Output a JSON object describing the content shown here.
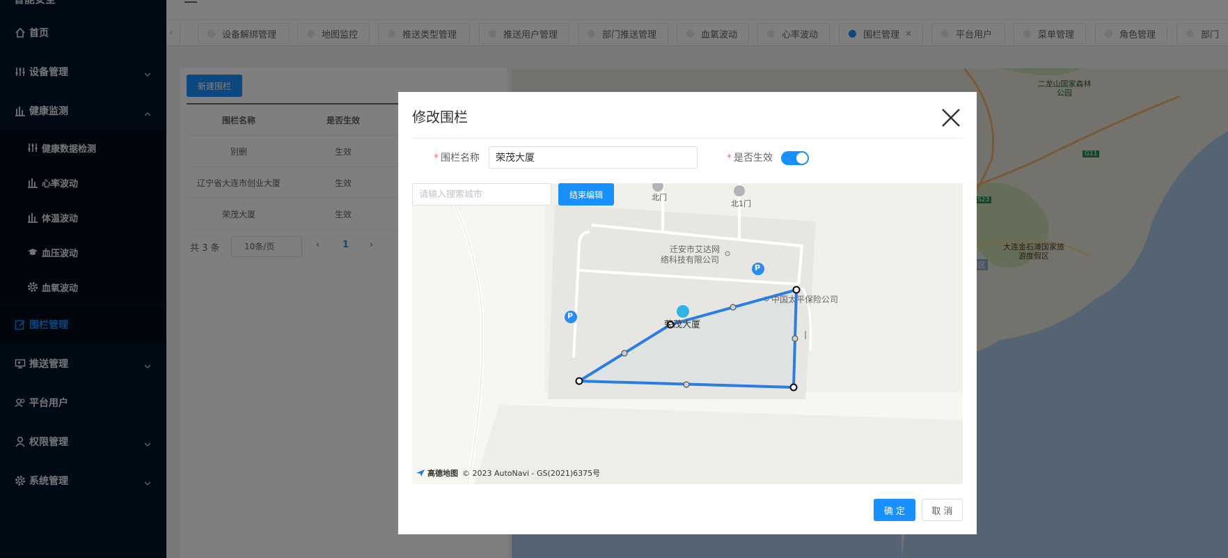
{
  "sidebar": {
    "logo_text": "智能安全",
    "items": [
      {
        "label": "首页",
        "icon": "home-icon"
      },
      {
        "label": "设备管理",
        "icon": "sliders-icon"
      },
      {
        "label": "健康监测",
        "icon": "bar-chart-icon"
      },
      {
        "label": "健康数据检测",
        "icon": "sliders-icon"
      },
      {
        "label": "心率波动",
        "icon": "bar-chart-icon"
      },
      {
        "label": "体温波动",
        "icon": "bar-chart-icon"
      },
      {
        "label": "血压波动",
        "icon": "graduation-cap-icon"
      },
      {
        "label": "血氧波动",
        "icon": "gear-icon"
      },
      {
        "label": "围栏管理",
        "icon": "edit-icon"
      },
      {
        "label": "推送管理",
        "icon": "push-icon"
      },
      {
        "label": "平台用户",
        "icon": "users-icon"
      },
      {
        "label": "权限管理",
        "icon": "user-icon"
      },
      {
        "label": "系统管理",
        "icon": "gear-icon"
      }
    ]
  },
  "tabs": [
    {
      "label": "设备解绑管理"
    },
    {
      "label": "地图监控"
    },
    {
      "label": "推送类型管理"
    },
    {
      "label": "推送用户管理"
    },
    {
      "label": "部门推送管理"
    },
    {
      "label": "血氧波动"
    },
    {
      "label": "心率波动"
    },
    {
      "label": "围栏管理",
      "active": true
    },
    {
      "label": "平台用户"
    },
    {
      "label": "菜单管理"
    },
    {
      "label": "角色管理"
    },
    {
      "label": "部门"
    }
  ],
  "tab_close": "×",
  "page": {
    "new_button": "新建围栏",
    "table": {
      "headers": [
        "围栏名称",
        "是否生效"
      ],
      "rows": [
        [
          "别删",
          "生效"
        ],
        [
          "辽宁省大连市创业大厦",
          "生效"
        ],
        [
          "荣茂大厦",
          "生效"
        ]
      ]
    },
    "pagination": {
      "total": "共 3 条",
      "page_size": "10条/页",
      "current": "1"
    }
  },
  "background_map": {
    "labels": [
      "二龙山国家森林公园",
      "大连金石滩国家旅游度假区",
      "金州区",
      "G11",
      "S23"
    ]
  },
  "modal": {
    "title": "修改围栏",
    "name_label": "围栏名称",
    "name_value": "荣茂大厦",
    "active_label": "是否生效",
    "active": true,
    "search_placeholder": "请输入搜索城市",
    "end_edit_button": "结束编辑",
    "map": {
      "labels": {
        "north_gate": "北门",
        "north_gate_1": "北1门",
        "company_line1": "迁安市艾达网",
        "company_line2": "络科技有限公司",
        "insurance": "中国太平保险公司",
        "building": "荣茂大厦",
        "parking": "P"
      },
      "logo_text": "高德地图",
      "copyright": "© 2023 AutoNavi - GS(2021)6375号"
    },
    "confirm_button": "确 定",
    "cancel_button": "取 消"
  },
  "colors": {
    "primary": "#1890ff",
    "sidebar_bg": "#001529",
    "fence_line": "#2a7de1"
  }
}
